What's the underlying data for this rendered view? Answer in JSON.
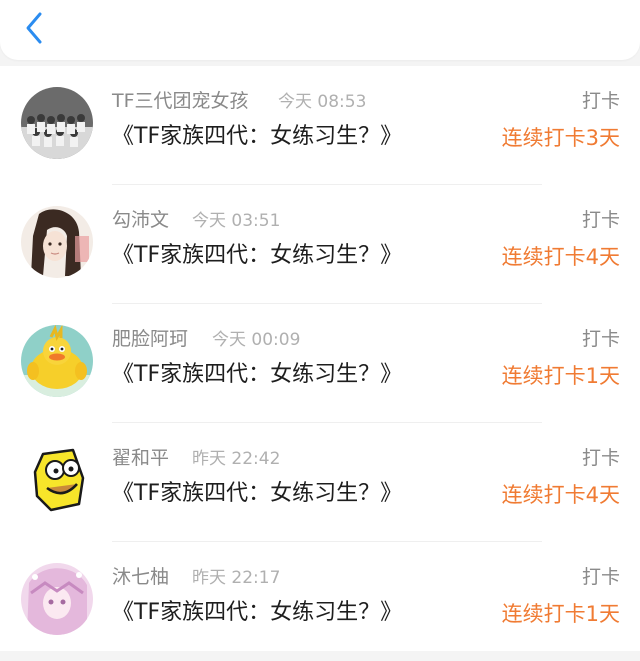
{
  "header": {
    "back_icon": "chevron-left-icon",
    "accent_color": "#2b8cf0"
  },
  "feed": [
    {
      "name": "TF三代团宠女孩",
      "time": "今天 08:53",
      "title": "《TF家族四代：女练习生？》",
      "action": "打卡",
      "streak": "连续打卡3天",
      "avatar": "group-photo-avatar"
    },
    {
      "name": "勾沛文",
      "time": "今天 03:51",
      "title": "《TF家族四代：女练习生？》",
      "action": "打卡",
      "streak": "连续打卡4天",
      "avatar": "anime-girl-avatar"
    },
    {
      "name": "肥脸阿珂",
      "time": "今天 00:09",
      "title": "《TF家族四代：女练习生？》",
      "action": "打卡",
      "streak": "连续打卡1天",
      "avatar": "yellow-chick-avatar"
    },
    {
      "name": "翟和平",
      "time": "昨天 22:42",
      "title": "《TF家族四代：女练习生？》",
      "action": "打卡",
      "streak": "连续打卡4天",
      "avatar": "cartoon-face-avatar"
    },
    {
      "name": "沐七柚",
      "time": "昨天 22:17",
      "title": "《TF家族四代：女练习生？》",
      "action": "打卡",
      "streak": "连续打卡1天",
      "avatar": "pink-anime-avatar"
    }
  ],
  "colors": {
    "streak": "#f07b33",
    "name": "#8a8a8a",
    "time": "#b0b0b0",
    "title": "#1e1e1e"
  }
}
